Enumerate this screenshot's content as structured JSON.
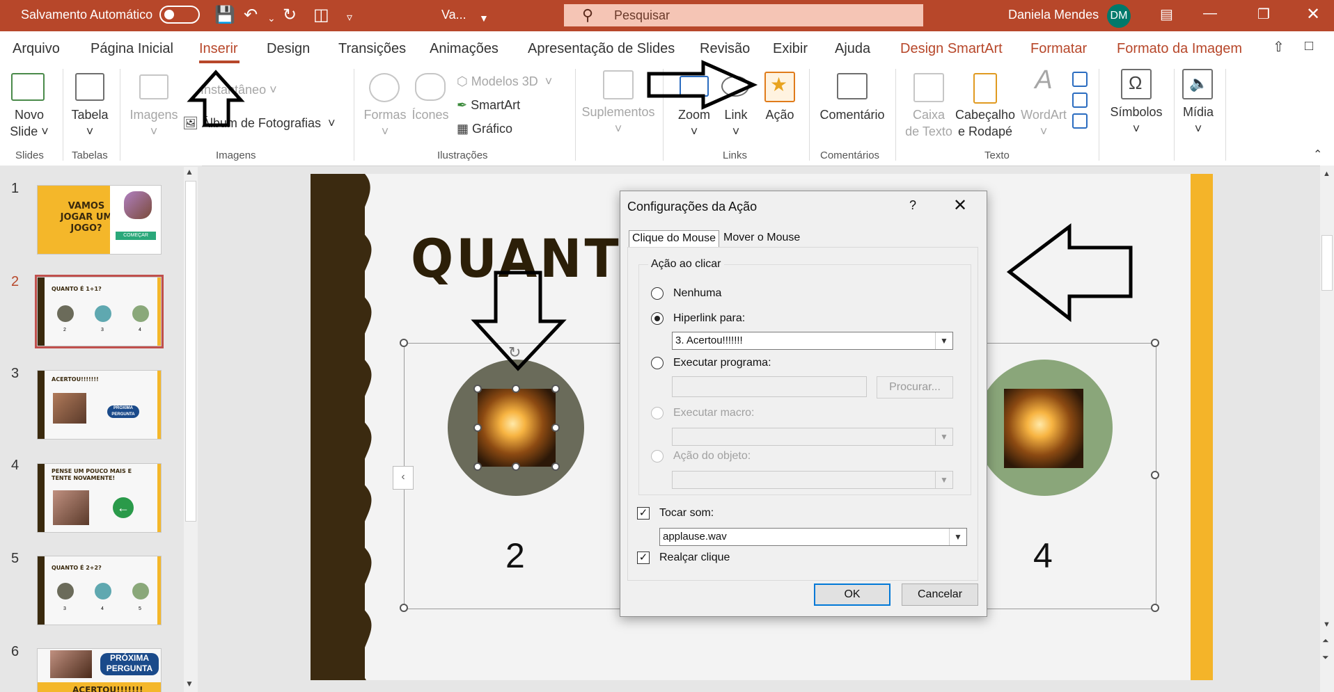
{
  "titlebar": {
    "autosave_label": "Salvamento Automático",
    "doc_name": "Va...",
    "search_placeholder": "Pesquisar",
    "user_name": "Daniela Mendes",
    "user_initials": "DM"
  },
  "menu": {
    "tabs": [
      "Arquivo",
      "Página Inicial",
      "Inserir",
      "Design",
      "Transições",
      "Animações",
      "Apresentação de Slides",
      "Revisão",
      "Exibir",
      "Ajuda",
      "Design SmartArt",
      "Formatar",
      "Formato da Imagem"
    ],
    "active": "Inserir"
  },
  "ribbon": {
    "novo_slide": "Novo",
    "novo_slide2": "Slide",
    "tabela": "Tabela",
    "imagens": "Imagens",
    "instantaneo": "Instantâneo",
    "album": "Álbum de Fotografias",
    "formas": "Formas",
    "icones": "Ícones",
    "modelos3d": "Modelos 3D",
    "smartart": "SmartArt",
    "grafico": "Gráfico",
    "suplementos": "Suplementos",
    "zoom": "Zoom",
    "link": "Link",
    "acao": "Ação",
    "comentario": "Comentário",
    "caixa1": "Caixa",
    "caixa2": "de Texto",
    "cab1": "Cabeçalho",
    "cab2": "e Rodapé",
    "wordart": "WordArt",
    "simbolos": "Símbolos",
    "midia": "Mídia",
    "groups": {
      "slides": "Slides",
      "tabelas": "Tabelas",
      "imagens": "Imagens",
      "ilustracoes": "Ilustrações",
      "links": "Links",
      "comentarios": "Comentários",
      "texto": "Texto"
    }
  },
  "thumbnails": {
    "nums": [
      "1",
      "2",
      "3",
      "4",
      "5",
      "6"
    ],
    "t1": "VAMOS JOGAR UM JOGO?",
    "t1_btn": "COMEÇAR",
    "t2": "QUANTO É 1+1?",
    "t2_labels": [
      "2",
      "3",
      "4"
    ],
    "t3": "ACERTOU!!!!!!!",
    "t3_btn": "PRÓXIMA PERGUNTA",
    "t4": "PENSE UM POUCO MAIS E TENTE NOVAMENTE!",
    "t5": "QUANTO É 2+2?",
    "t5_labels": [
      "3",
      "4",
      "5"
    ],
    "t6_btn": "PRÓXIMA PERGUNTA",
    "t6": "ACERTOU!!!!!!!"
  },
  "slide": {
    "title": "QUANTO É 1",
    "answers": [
      "2",
      "4"
    ]
  },
  "dialog": {
    "title": "Configurações da Ação",
    "help": "?",
    "tab_click": "Clique do Mouse",
    "tab_hover": "Mover o Mouse",
    "group_label": "Ação ao clicar",
    "nenhuma": "Nenhuma",
    "hiperlink": "Hiperlink para:",
    "hiperlink_value": "3. Acertou!!!!!!!",
    "executar_programa": "Executar programa:",
    "procurar": "Procurar...",
    "executar_macro": "Executar macro:",
    "acao_objeto": "Ação do objeto:",
    "tocar_som": "Tocar som:",
    "som_value": "applause.wav",
    "realcar": "Realçar clique",
    "ok": "OK",
    "cancelar": "Cancelar"
  },
  "colors": {
    "accent": "#b7472a",
    "slide_brown": "#3b2a10",
    "slide_gold": "#f4b429"
  }
}
